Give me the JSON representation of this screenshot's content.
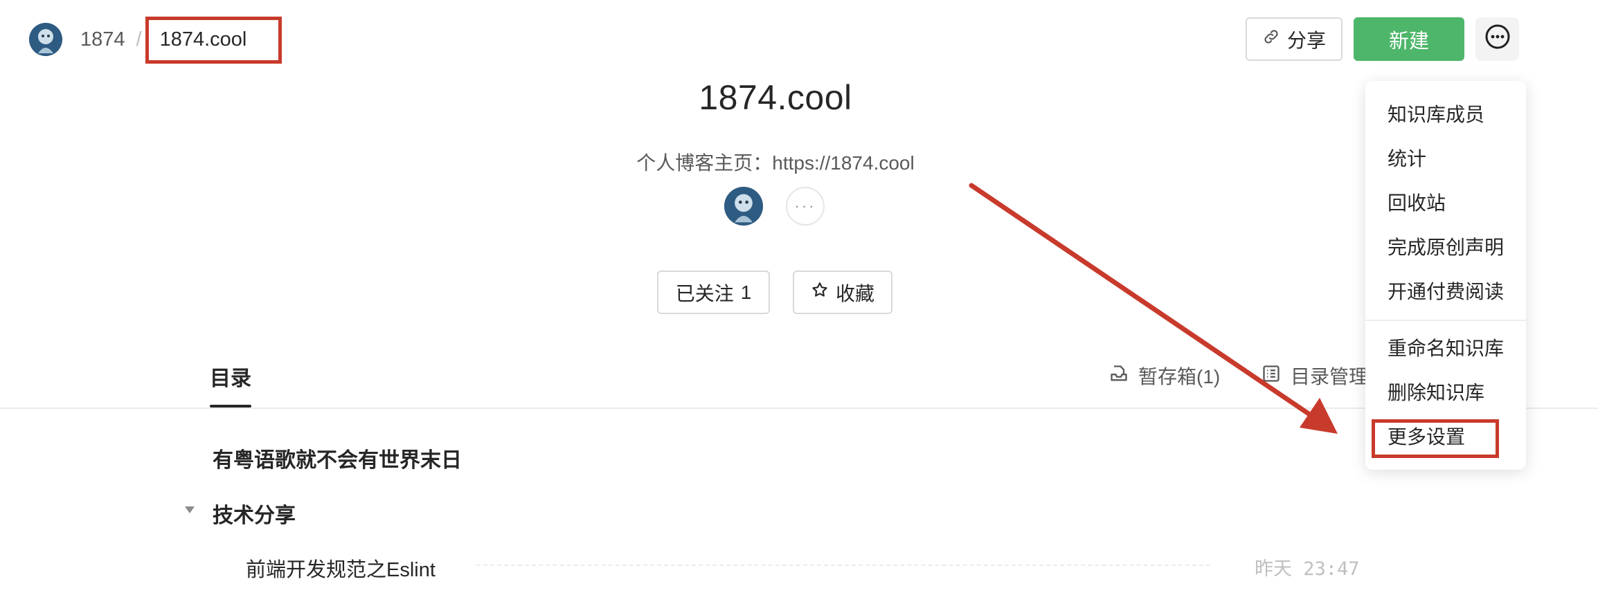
{
  "breadcrumb": {
    "root": "1874",
    "separator": "/",
    "current": "1874.cool"
  },
  "header": {
    "share_label": "分享",
    "new_label": "新建",
    "more_icon": "more-circle-icon"
  },
  "book": {
    "title": "1874.cool",
    "description": "个人博客主页：https://1874.cool",
    "more_dots": "···",
    "follow_label": "已关注",
    "follow_count": "1",
    "favorite_label": "收藏"
  },
  "tabs": {
    "toc_label": "目录",
    "draft_box_label": "暂存箱(1)",
    "toc_manage_label": "目录管理"
  },
  "tree": {
    "items": [
      {
        "title": "有粤语歌就不会有世界末日"
      },
      {
        "title": "技术分享"
      },
      {
        "title": "前端开发规范之Eslint",
        "time": "昨天 23:47"
      }
    ]
  },
  "menu": {
    "items": [
      "知识库成员",
      "统计",
      "回收站",
      "完成原创声明",
      "开通付费阅读",
      "重命名知识库",
      "删除知识库",
      "更多设置"
    ]
  },
  "colors": {
    "primary": "#4db66a",
    "annotation": "#c83a2b"
  }
}
